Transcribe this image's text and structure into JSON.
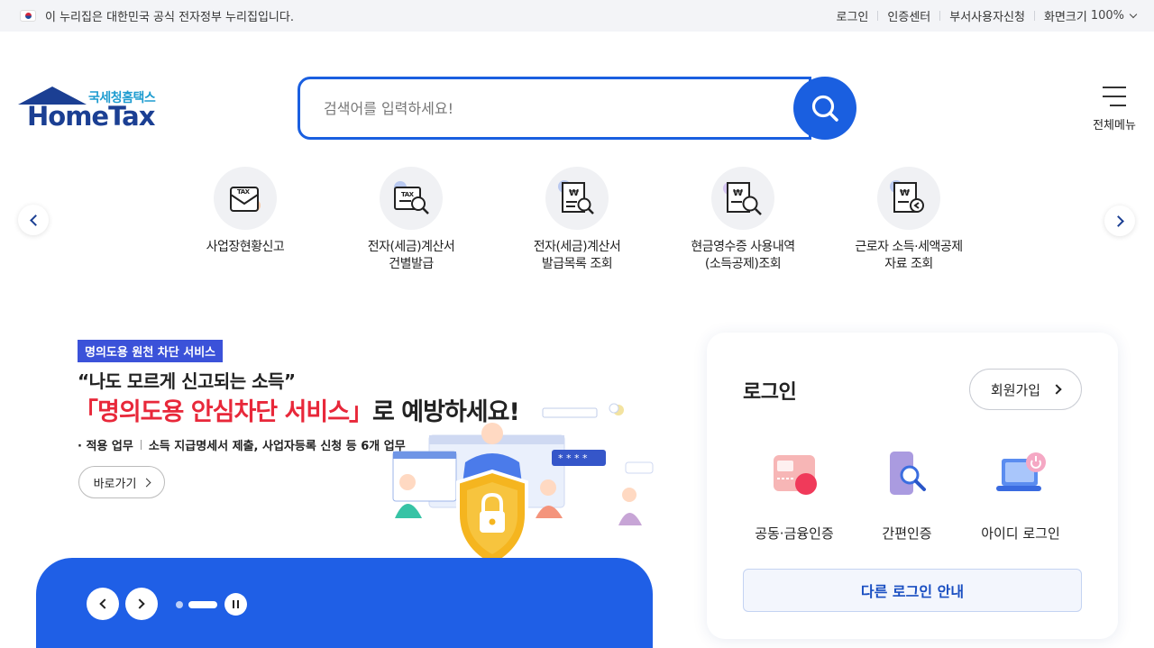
{
  "topbar": {
    "gov_notice": "이 누리집은 대한민국 공식 전자정부 누리집입니다.",
    "links": [
      "로그인",
      "인증센터",
      "부서사용자신청"
    ],
    "zoom_label": "화면크기",
    "zoom_value": "100%"
  },
  "logo": {
    "ko": "국세청홈택스",
    "en": "HomeTax"
  },
  "search": {
    "placeholder": "검색어를 입력하세요!"
  },
  "menu": {
    "label": "전체메뉴"
  },
  "quick_menu": [
    {
      "label": "사업장현황신고",
      "icon": "tax-envelope-icon"
    },
    {
      "label": "전자(세금)계산서\n건별발급",
      "icon": "tax-invoice-search-icon"
    },
    {
      "label": "전자(세금)계산서\n발급목록 조회",
      "icon": "receipt-search-icon"
    },
    {
      "label": "현금영수증 사용내역\n(소득공제)조회",
      "icon": "receipt-magnify-icon"
    },
    {
      "label": "근로자 소득·세액공제\n자료 조회",
      "icon": "receipt-arrow-icon"
    }
  ],
  "banner": {
    "badge": "명의도용 원천 차단 서비스",
    "quote": "“나도 모르게 신고되는 소득”",
    "headline_red": "「명의도용 안심차단 서비스」",
    "headline_rest": "로 예방하세요!",
    "sub_label": "· 적용 업무",
    "sub_text": "소득 지급명세서 제출, 사업자등록 신청 등 6개 업무",
    "button": "바로가기",
    "slide_index": 1
  },
  "login": {
    "title": "로그인",
    "join": "회원가입",
    "options": [
      "공동·금융인증",
      "간편인증",
      "아이디 로그인"
    ],
    "other": "다른 로그인 안내"
  },
  "colors": {
    "primary": "#1a5fe0",
    "brand_navy": "#1b3f93",
    "accent_red": "#e8283a"
  }
}
